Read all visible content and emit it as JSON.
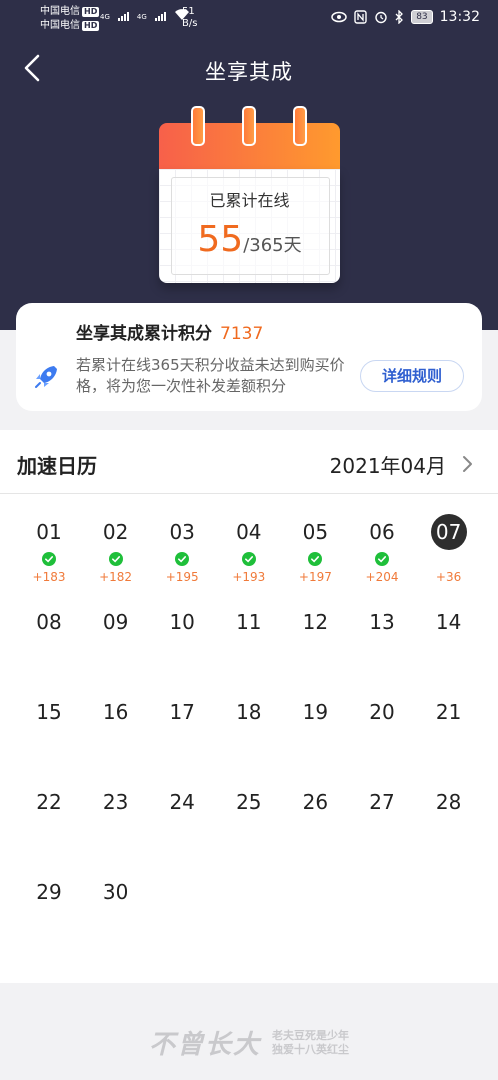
{
  "status_bar": {
    "carrier1": "中国电信",
    "carrier2": "中国电信",
    "hd_badge": "HD",
    "net1": "4G",
    "net2": "4G",
    "speed_value": "51",
    "speed_unit": "B/s",
    "battery": "83",
    "time": "13:32"
  },
  "header": {
    "title": "坐享其成"
  },
  "calendar_widget": {
    "label": "已累计在线",
    "days_online": "55",
    "days_total": "/365天"
  },
  "points_card": {
    "title": "坐享其成累计积分",
    "points": "7137",
    "description": "若累计在线365天积分收益未达到购买价格，将为您一次性补发差额积分",
    "rule_button": "详细规则"
  },
  "accelerate_calendar": {
    "title": "加速日历",
    "month": "2021年04月",
    "days": [
      {
        "n": "01",
        "gain": "+183",
        "checked": true
      },
      {
        "n": "02",
        "gain": "+182",
        "checked": true
      },
      {
        "n": "03",
        "gain": "+195",
        "checked": true
      },
      {
        "n": "04",
        "gain": "+193",
        "checked": true
      },
      {
        "n": "05",
        "gain": "+197",
        "checked": true
      },
      {
        "n": "06",
        "gain": "+204",
        "checked": true
      },
      {
        "n": "07",
        "gain": "+36",
        "checked": false,
        "today": true
      },
      {
        "n": "08"
      },
      {
        "n": "09"
      },
      {
        "n": "10"
      },
      {
        "n": "11"
      },
      {
        "n": "12"
      },
      {
        "n": "13"
      },
      {
        "n": "14"
      },
      {
        "n": "15"
      },
      {
        "n": "16"
      },
      {
        "n": "17"
      },
      {
        "n": "18"
      },
      {
        "n": "19"
      },
      {
        "n": "20"
      },
      {
        "n": "21"
      },
      {
        "n": "22"
      },
      {
        "n": "23"
      },
      {
        "n": "24"
      },
      {
        "n": "25"
      },
      {
        "n": "26"
      },
      {
        "n": "27"
      },
      {
        "n": "28"
      },
      {
        "n": "29"
      },
      {
        "n": "30"
      }
    ]
  },
  "watermark": {
    "main": "不曾长大",
    "line1": "老夫豆死是少年",
    "line2": "独爱十八英红尘"
  },
  "colors": {
    "header_bg": "#2e2f48",
    "accent_orange": "#f06a1f",
    "check_green": "#1fbf3a",
    "link_blue": "#2f5fd0"
  }
}
